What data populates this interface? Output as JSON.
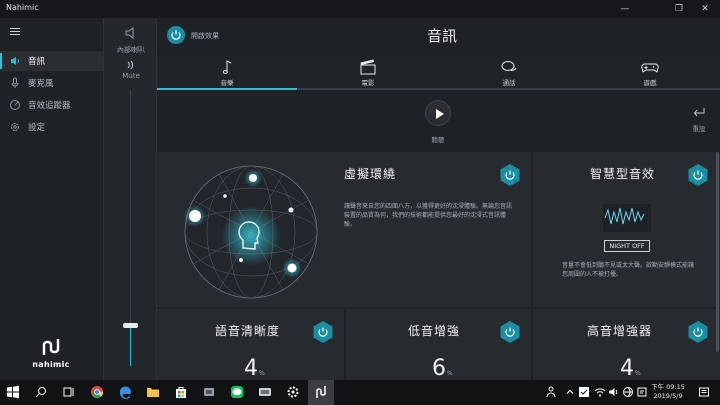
{
  "window": {
    "title": "Nahimic",
    "minimize": "—",
    "maximize": "❐",
    "close": "✕"
  },
  "sidebar": {
    "items": [
      {
        "label": "音訊",
        "icon": "speaker-icon",
        "active": true
      },
      {
        "label": "麥克風",
        "icon": "microphone-icon",
        "active": false
      },
      {
        "label": "音效追蹤器",
        "icon": "tracker-icon",
        "active": false
      },
      {
        "label": "設定",
        "icon": "gear-icon",
        "active": false
      }
    ],
    "brand": "nahimic"
  },
  "volume": {
    "device_label": "內部喇叭",
    "mute_label": "Mute",
    "level": 0.15
  },
  "header": {
    "effect_label": "開啟效果",
    "title": "音訊"
  },
  "tabs": [
    {
      "label": "音樂",
      "icon": "music-note-icon",
      "active": true
    },
    {
      "label": "電影",
      "icon": "clapperboard-icon",
      "active": false
    },
    {
      "label": "通話",
      "icon": "chat-bubble-icon",
      "active": false
    },
    {
      "label": "遊戲",
      "icon": "gamepad-icon",
      "active": false
    }
  ],
  "controls": {
    "play_label": "聽聽",
    "reset_label": "重設"
  },
  "cards": {
    "surround": {
      "title": "虛擬環繞",
      "desc": "讓聲音來自您的四面八方，以獲得更好的沈浸體驗。無論您音訊裝置的品質為何，我們的技術都能提供您最好的沈浸式音訊體驗。"
    },
    "smart": {
      "title": "智慧型音效",
      "badge": "NIGHT OFF",
      "desc": "音量不會低到聽不見或太大聲。啟動安靜模式能讓您周圍的人不被打擾。"
    },
    "voice": {
      "title": "語音清晰度",
      "value": "4",
      "unit": "%"
    },
    "bass": {
      "title": "低音增強",
      "value": "6",
      "unit": "%"
    },
    "treble": {
      "title": "高音增強器",
      "value": "4",
      "unit": "%"
    }
  },
  "taskbar": {
    "time": "下午 09:15",
    "date": "2019/5/9"
  },
  "colors": {
    "accent": "#2bc0d8",
    "teal_button": "#1a8ea3"
  }
}
